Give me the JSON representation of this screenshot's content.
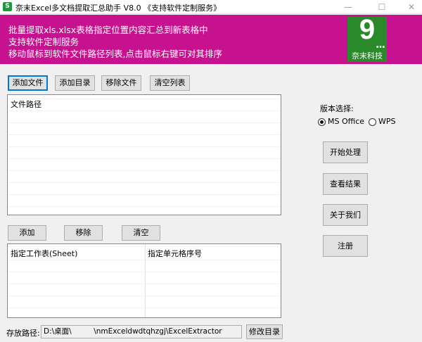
{
  "window": {
    "title": "奈末Excel多文档提取汇总助手 V8.0 《支持软件定制服务》",
    "icon_letter": "S",
    "minimize_glyph": "—",
    "maximize_glyph": "☐",
    "close_glyph": "✕"
  },
  "banner": {
    "line1": "批量提取xls.xlsx表格指定位置内容汇总到新表格中",
    "line2": "支持软件定制服务",
    "line3": "移动鼠标到软件文件路径列表,点击鼠标右键可对其排序",
    "background_color": "#c7128f",
    "logo": {
      "numeral": "9",
      "dots": "...",
      "name": "奈末科技",
      "color": "#2a8a2a"
    }
  },
  "file_toolbar": {
    "add_file": "添加文件",
    "add_folder": "添加目录",
    "remove_file": "移除文件",
    "clear_list": "清空列表"
  },
  "file_list": {
    "header": "文件路径",
    "rows": []
  },
  "sheet_toolbar": {
    "add": "添加",
    "remove": "移除",
    "clear": "清空"
  },
  "sheet_list": {
    "col1_header": "指定工作表(Sheet)",
    "col2_header": "指定单元格序号",
    "rows": []
  },
  "version": {
    "label": "版本选择:",
    "options": [
      {
        "label": "MS Office",
        "checked": true
      },
      {
        "label": "WPS",
        "checked": false
      }
    ]
  },
  "actions": {
    "start": "开始处理",
    "view_result": "查看结果",
    "about": "关于我们",
    "register": "注册"
  },
  "output": {
    "label": "存放路径:",
    "path": "D:\\桌面\\　　　\\nmExceldwdtqhzgj\\ExcelExtractor",
    "change_dir": "修改目录"
  }
}
